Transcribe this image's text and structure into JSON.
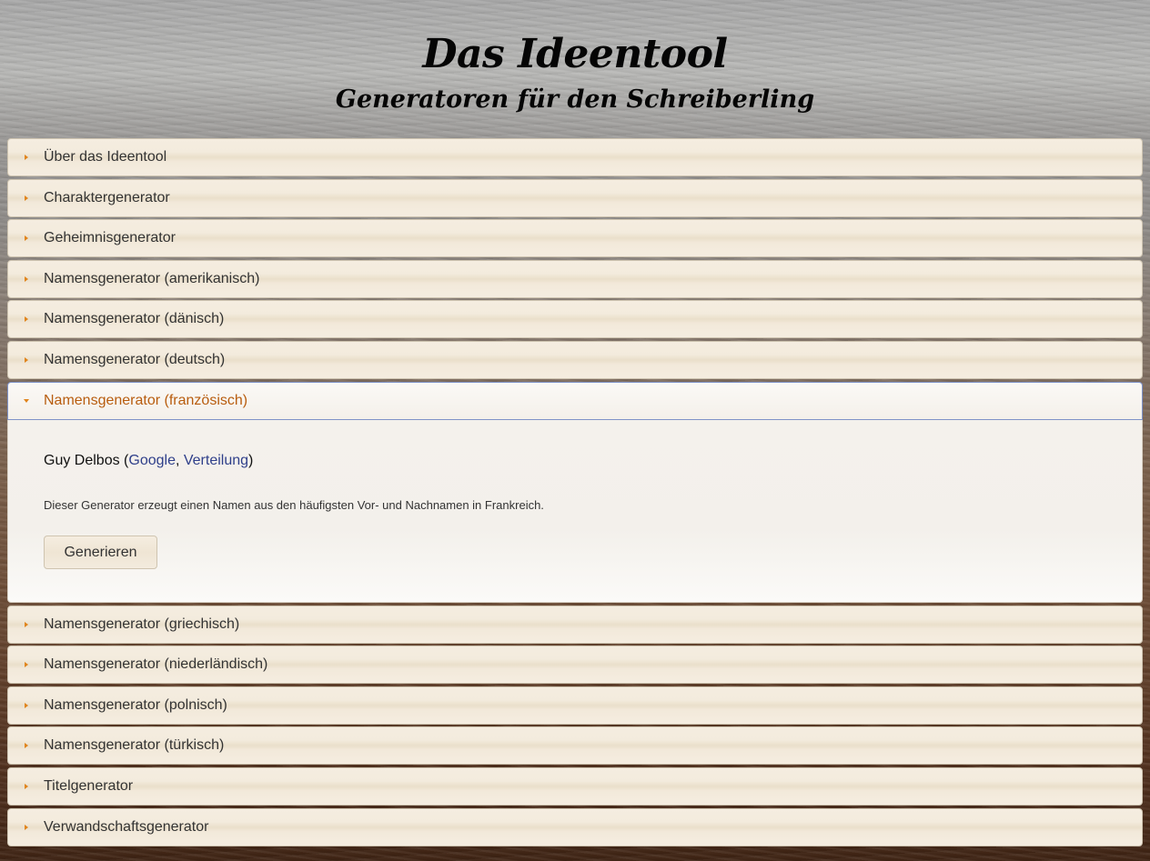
{
  "header": {
    "title": "Das Ideentool",
    "subtitle": "Generatoren für den Schreiberling"
  },
  "colors": {
    "accent": "#b85d0f",
    "arrow": "#e0841c",
    "link": "#2f3f8a",
    "active_border": "#7f93c8"
  },
  "accordion": {
    "items_before": [
      {
        "label": "Über das Ideentool"
      },
      {
        "label": "Charaktergenerator"
      },
      {
        "label": "Geheimnisgenerator"
      },
      {
        "label": "Namensgenerator (amerikanisch)"
      },
      {
        "label": "Namensgenerator (dänisch)"
      },
      {
        "label": "Namensgenerator (deutsch)"
      }
    ],
    "active": {
      "label": "Namensgenerator (französisch)",
      "result_name": "Guy Delbos",
      "link_google": "Google",
      "link_verteilung": "Verteilung",
      "description": "Dieser Generator erzeugt einen Namen aus den häufigsten Vor- und Nachnamen in Frankreich.",
      "button_label": "Generieren"
    },
    "items_after": [
      {
        "label": "Namensgenerator (griechisch)"
      },
      {
        "label": "Namensgenerator (niederländisch)"
      },
      {
        "label": "Namensgenerator (polnisch)"
      },
      {
        "label": "Namensgenerator (türkisch)"
      },
      {
        "label": "Titelgenerator"
      },
      {
        "label": "Verwandschaftsgenerator"
      }
    ]
  }
}
